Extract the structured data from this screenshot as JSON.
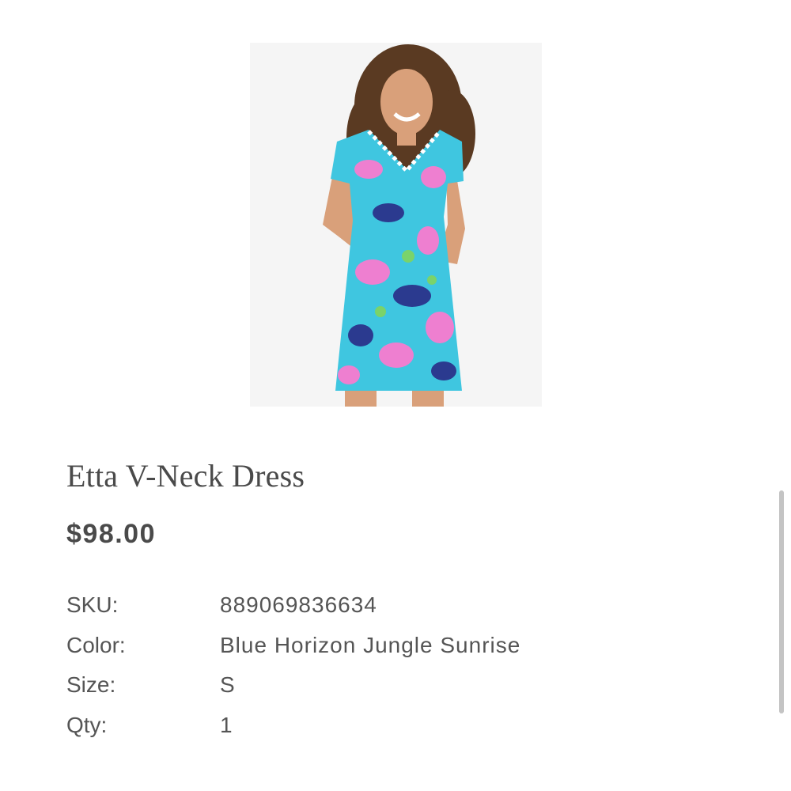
{
  "product": {
    "title": "Etta V-Neck Dress",
    "price": "$98.00",
    "image_icon": "product-photo-dress",
    "details": {
      "sku": {
        "label": "SKU:",
        "value": "889069836634"
      },
      "color": {
        "label": "Color:",
        "value": "Blue Horizon Jungle Sunrise"
      },
      "size": {
        "label": "Size:",
        "value": "S"
      },
      "qty": {
        "label": "Qty:",
        "value": "1"
      }
    }
  },
  "colors": {
    "text": "#4a4a4a",
    "image_background": "#f5f5f5",
    "dress_base": "#3fc6e0",
    "dress_pink": "#ee7fd0",
    "dress_navy": "#2b3a8f",
    "scrollbar": "#c4c4c4"
  }
}
